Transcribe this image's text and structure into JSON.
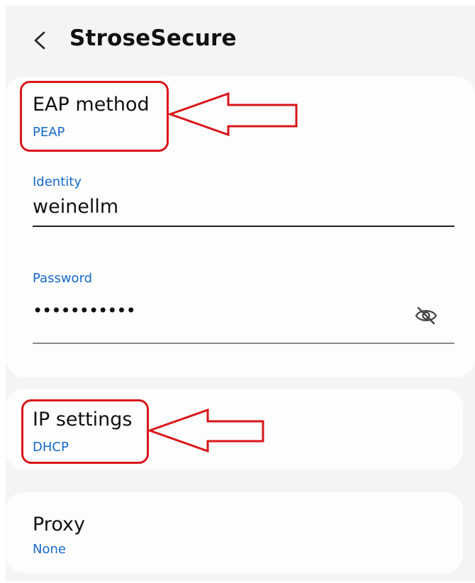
{
  "header": {
    "title": "StroseSecure"
  },
  "eap": {
    "label": "EAP method",
    "value": "PEAP"
  },
  "identity": {
    "label": "Identity",
    "value": "weinellm"
  },
  "password": {
    "label": "Password",
    "value": "•••••••••••"
  },
  "ip": {
    "label": "IP settings",
    "value": "DHCP"
  },
  "proxy": {
    "label": "Proxy",
    "value": "None"
  },
  "colors": {
    "accent": "#1769c9",
    "annotation": "#d9151a"
  }
}
